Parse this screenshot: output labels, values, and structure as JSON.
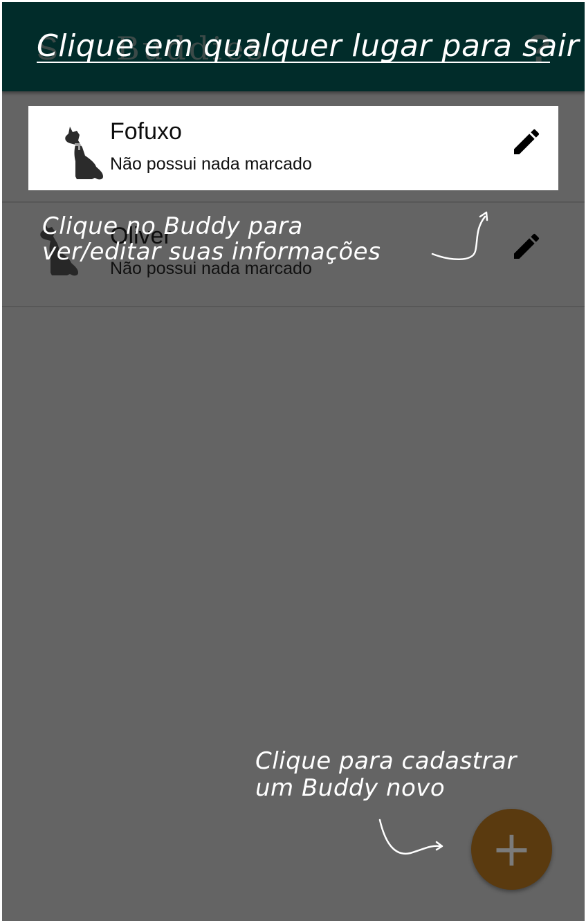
{
  "app_bar": {
    "title": "Buddies",
    "help_icon": "help-icon"
  },
  "tutorial": {
    "exit_hint": "Clique em qualquer lugar para sair",
    "list_hint_line1": "Clique no Buddy para",
    "list_hint_line2": "ver/editar suas informações",
    "add_hint_line1": "Clique para cadastrar",
    "add_hint_line2": "um Buddy novo"
  },
  "buddies": [
    {
      "name": "Fofuxo",
      "status": "Não possui nada marcado",
      "icon": "dog-icon",
      "action_icon": "pencil-icon"
    },
    {
      "name": "Oliver",
      "status": "Não possui nada marcado",
      "icon": "dog-icon",
      "action_icon": "pencil-icon"
    }
  ],
  "fab": {
    "label": "+",
    "icon": "plus-icon"
  },
  "colors": {
    "app_bar": "#012c2a",
    "overlay": "#646464",
    "fab": "#5a3a0f",
    "hint_text": "#ffffff"
  }
}
